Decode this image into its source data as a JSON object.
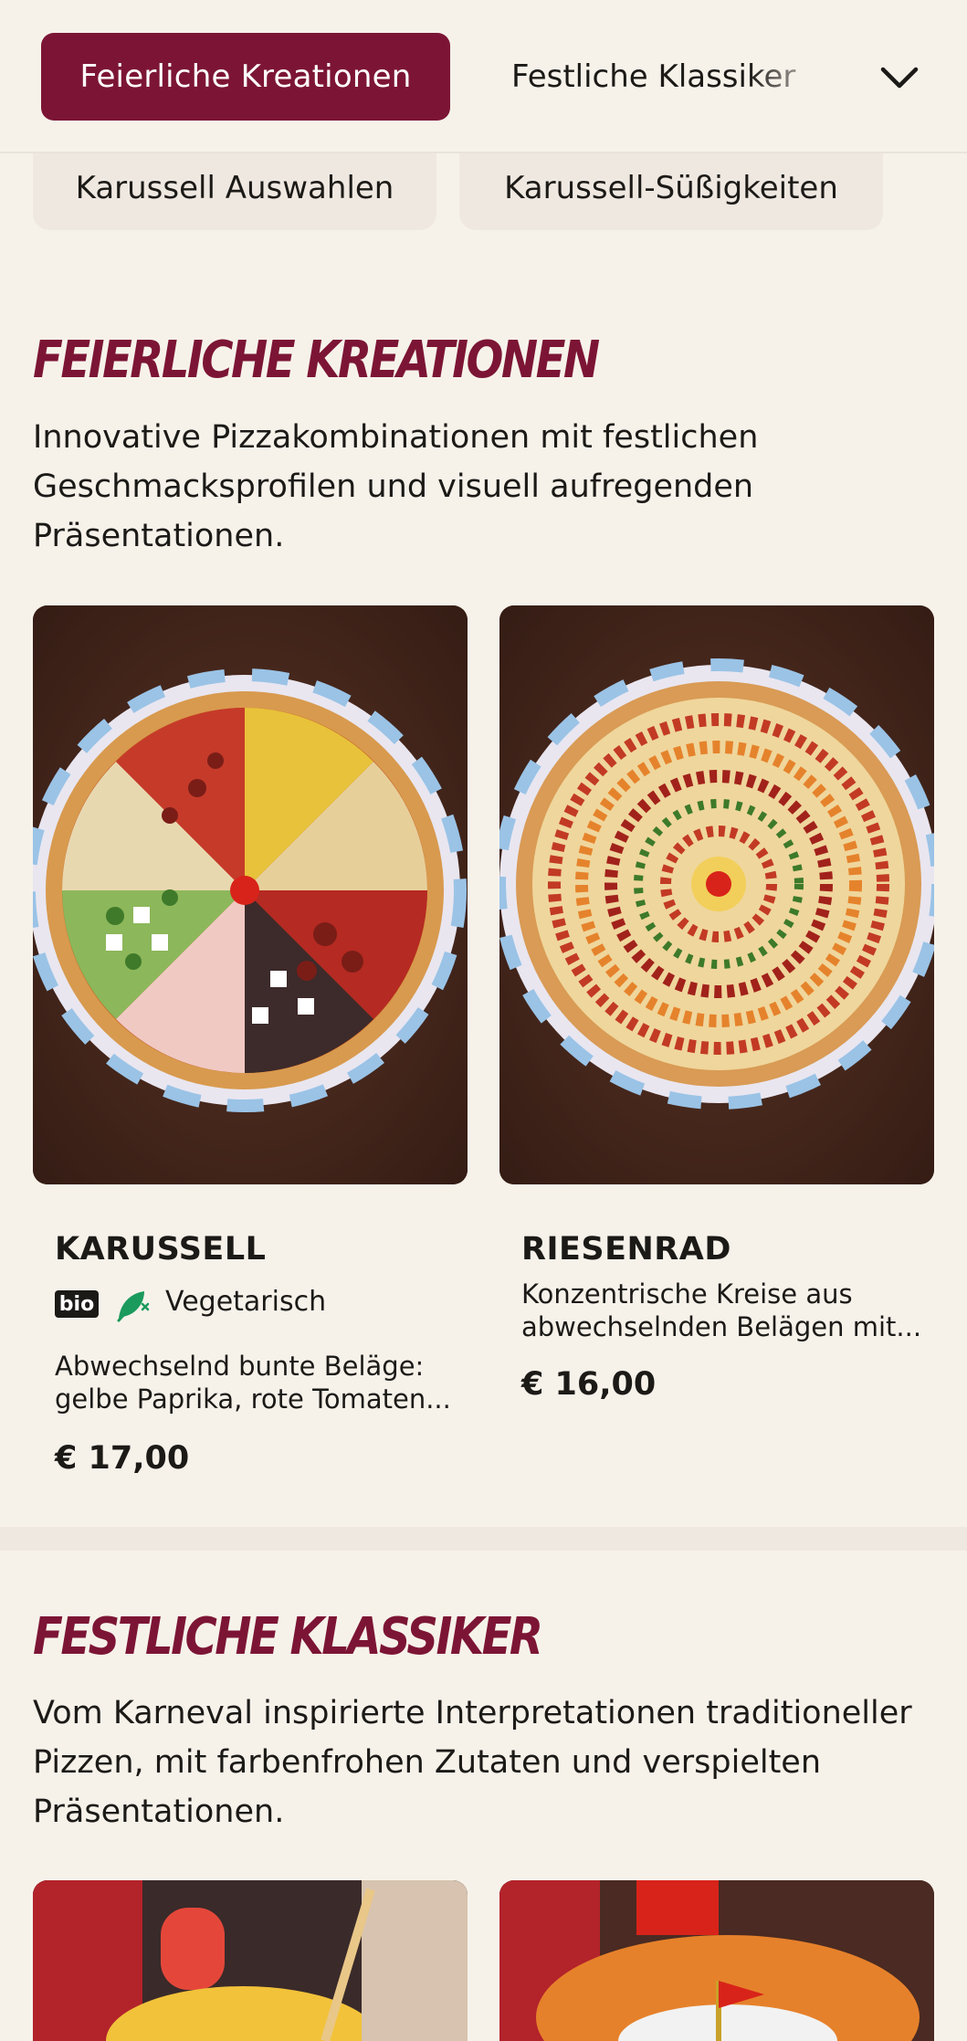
{
  "nav": {
    "active_tab": "Feierliche Kreationen",
    "next_tab": "Festliche Klassiker",
    "chips": [
      "Karussell Auswahlen",
      "Karussell-Süßigkeiten"
    ]
  },
  "sections": [
    {
      "title": "Feierliche Kreationen",
      "description": "Innovative Pizzakombinationen mit festlichen Geschmacksprofilen und visuell aufregenden Präsentationen.",
      "items": [
        {
          "name": "KARUSSELL",
          "badge": "bio",
          "diet_label": "Vegetarisch",
          "diet_icon": "vegetarian-leaf-icon",
          "description": "Abwechselnd bunte Beläge: gelbe Paprika, rote Tomaten...",
          "price": "€ 17,00"
        },
        {
          "name": "RIESENRAD",
          "description": "Konzentrische Kreise aus abwechselnden Belägen mit...",
          "price": "€ 16,00"
        }
      ]
    },
    {
      "title": "Festliche Klassiker",
      "description": "Vom Karneval inspirierte Interpretationen traditioneller Pizzen, mit farbenfrohen Zutaten und verspielten Präsentationen."
    }
  ],
  "colors": {
    "accent": "#7c1535",
    "background": "#f6f2ea",
    "chip": "#efe8e1",
    "veg": "#1a9a5c"
  }
}
